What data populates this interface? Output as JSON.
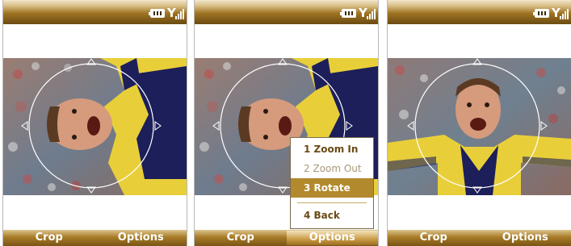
{
  "screens": [
    {
      "id": "screen-1",
      "softkeys": {
        "left": "Crop",
        "right": "Options"
      }
    },
    {
      "id": "screen-2",
      "softkeys": {
        "left": "Crop",
        "right": "Options"
      },
      "menu": {
        "items": [
          {
            "label": "1 Zoom In",
            "state": "enabled"
          },
          {
            "label": "2 Zoom Out",
            "state": "disabled"
          },
          {
            "label": "3 Rotate",
            "state": "selected"
          },
          {
            "label": "4 Back",
            "state": "enabled"
          }
        ]
      }
    },
    {
      "id": "screen-3",
      "softkeys": {
        "left": "Crop",
        "right": "Options"
      }
    }
  ],
  "colors": {
    "accent_gold": "#b3892d",
    "menu_text": "#6a4a14",
    "menu_disabled": "#a89878",
    "shirt_yellow": "#e8cf3a",
    "shirt_navy": "#1c1f5a"
  },
  "icons": [
    "battery-icon",
    "signal-icon",
    "crop-circle",
    "arrow-up-icon",
    "arrow-down-icon",
    "arrow-left-icon",
    "arrow-right-icon"
  ]
}
